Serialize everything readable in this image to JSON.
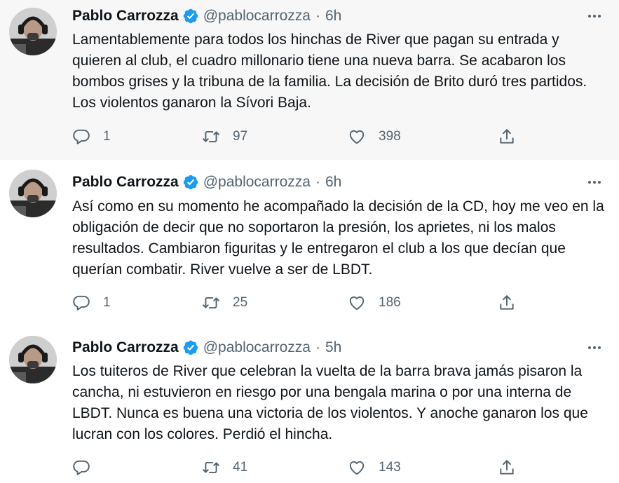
{
  "tweets": [
    {
      "name": "Pablo Carrozza",
      "handle": "@pablocarrozza",
      "separator": "·",
      "time": "6h",
      "text": "Lamentablemente para todos los hinchas de River que pagan su entrada y quieren al club, el cuadro millonario tiene una nueva barra. Se acabaron los bombos grises y la tribuna de la familia. La decisión de Brito duró tres partidos. Los violentos ganaron la Sívori Baja.",
      "replies": "1",
      "retweets": "97",
      "likes": "398"
    },
    {
      "name": "Pablo Carrozza",
      "handle": "@pablocarrozza",
      "separator": "·",
      "time": "6h",
      "text": "Así como en su momento he acompañado la decisión de la CD, hoy me veo en la obligación de decir que no soportaron la presión, los aprietes, ni los malos resultados. Cambiaron figuritas y le entregaron el club a los que decían que querían combatir. River vuelve a ser de LBDT.",
      "replies": "1",
      "retweets": "25",
      "likes": "186"
    },
    {
      "name": "Pablo Carrozza",
      "handle": "@pablocarrozza",
      "separator": "·",
      "time": "5h",
      "text": "Los tuiteros de River que celebran la vuelta de la barra brava jamás pisaron la cancha, ni estuvieron en riesgo por una bengala marina o por una interna de LBDT. Nunca es buena una victoria de los violentos. Y anoche ganaron los que lucran con los colores. Perdió el hincha.",
      "replies": "",
      "retweets": "41",
      "likes": "143"
    }
  ],
  "icons": {
    "reply": "reply-icon",
    "retweet": "retweet-icon",
    "like": "like-icon",
    "share": "share-icon",
    "more": "more-icon",
    "verified": "verified-badge-icon"
  },
  "colors": {
    "verified_blue": "#1d9bf0",
    "secondary_text": "#536471",
    "primary_text": "#0f1419",
    "highlight_bg": "#f7f7f7",
    "thread_line": "#cfd9de"
  }
}
